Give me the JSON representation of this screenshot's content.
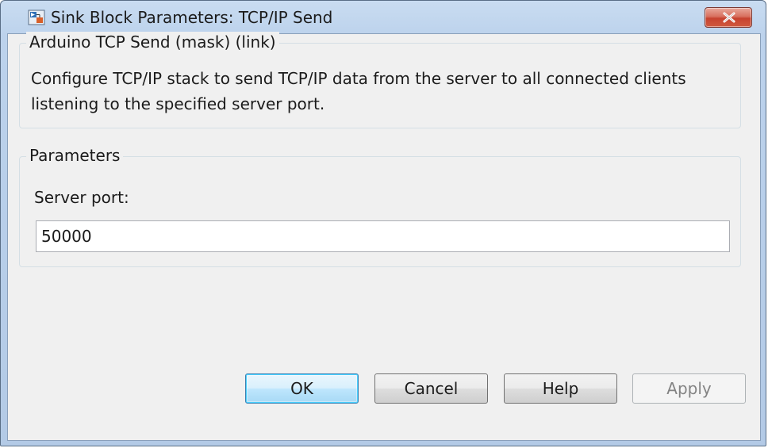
{
  "window": {
    "title": "Sink Block Parameters: TCP/IP Send",
    "close_label": "Close"
  },
  "description_group": {
    "legend": "Arduino TCP Send (mask) (link)",
    "text": "Configure TCP/IP stack to send TCP/IP data from the server to all connected clients listening to the specified server port."
  },
  "parameters_group": {
    "legend": "Parameters",
    "server_port": {
      "label": "Server port:",
      "value": "50000"
    }
  },
  "buttons": {
    "ok": "OK",
    "cancel": "Cancel",
    "help": "Help",
    "apply": "Apply"
  },
  "icons": {
    "app": "simulink-block-icon",
    "close": "close-x-icon"
  },
  "colors": {
    "title_bar": "#bcd2ec",
    "dialog_background": "#f0f0f0",
    "close_button": "#c7422f",
    "default_button_accent": "#3c7fb1",
    "disabled_text": "#838383"
  }
}
